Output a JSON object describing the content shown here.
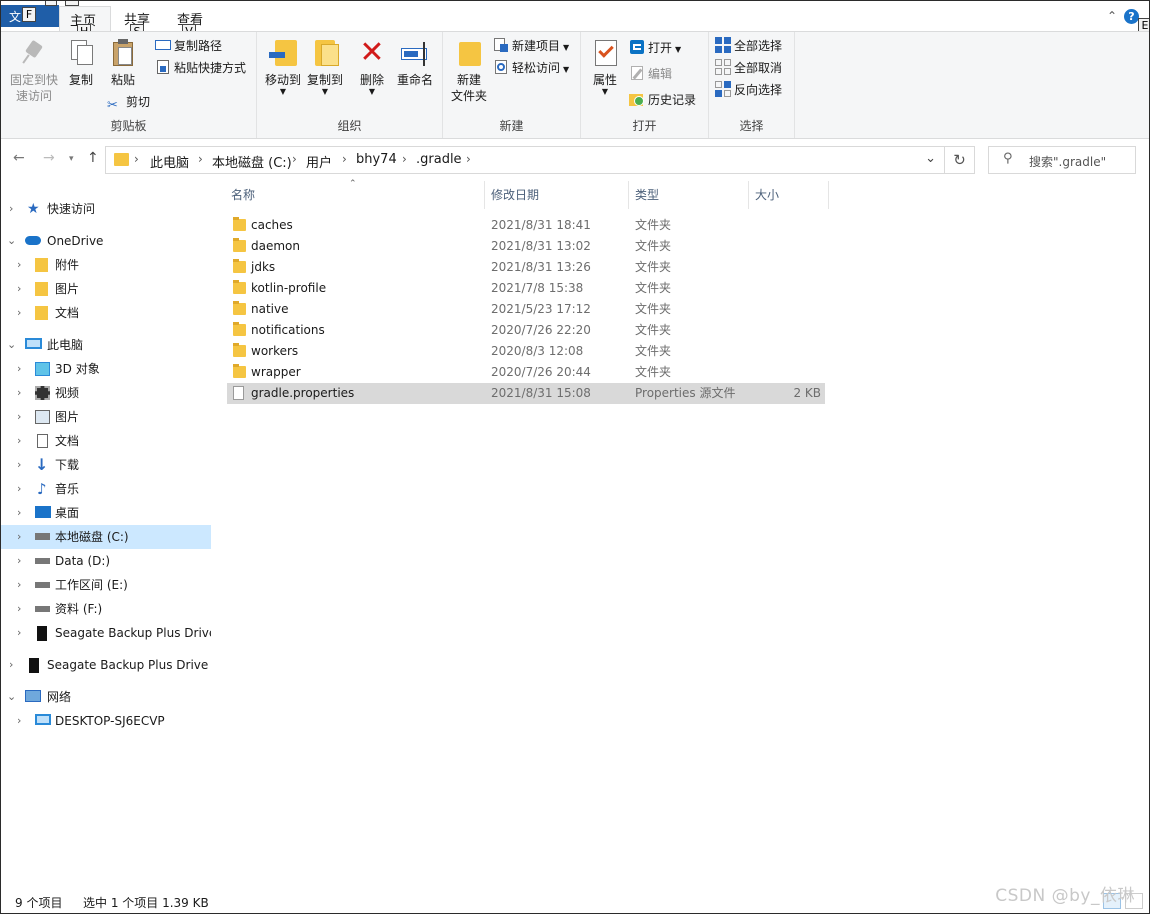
{
  "ribbon_tabs": {
    "file": "文",
    "home": "主页",
    "share": "共享",
    "view": "查看",
    "keytips": {
      "file": "F",
      "home": "H",
      "share": "S",
      "view": "V",
      "expand": "E"
    }
  },
  "ribbon": {
    "clipboard": {
      "pin_line1": "固定到快",
      "pin_line2": "速访问",
      "copy": "复制",
      "paste": "粘贴",
      "copy_path": "复制路径",
      "paste_shortcut": "粘贴快捷方式",
      "cut": "剪切",
      "label": "剪贴板"
    },
    "organize": {
      "move_to": "移动到",
      "copy_to": "复制到",
      "delete": "删除",
      "rename": "重命名",
      "label": "组织"
    },
    "new": {
      "new_folder_line1": "新建",
      "new_folder_line2": "文件夹",
      "new_item": "新建项目",
      "easy_access": "轻松访问",
      "label": "新建"
    },
    "open": {
      "properties": "属性",
      "open": "打开",
      "edit": "编辑",
      "history": "历史记录",
      "label": "打开"
    },
    "select": {
      "select_all": "全部选择",
      "select_none": "全部取消",
      "invert": "反向选择",
      "label": "选择"
    }
  },
  "address": {
    "crumbs": [
      "此电脑",
      "本地磁盘 (C:)",
      "用户",
      "bhy74",
      ".gradle"
    ],
    "search_placeholder": "搜索\".gradle\""
  },
  "nav": {
    "quick_access": "快速访问",
    "onedrive": "OneDrive",
    "od_attachments": "附件",
    "od_pictures": "图片",
    "od_documents": "文档",
    "this_pc": "此电脑",
    "objects3d": "3D 对象",
    "videos": "视频",
    "pictures": "图片",
    "documents": "文档",
    "downloads": "下载",
    "music": "音乐",
    "desktop": "桌面",
    "drive_c": "本地磁盘 (C:)",
    "drive_d": "Data (D:)",
    "drive_e": "工作区间 (E:)",
    "drive_f": "资料 (F:)",
    "seagate1": "Seagate Backup Plus Drive",
    "seagate2": "Seagate Backup Plus Drive (",
    "network": "网络",
    "desktop_pc": "DESKTOP-SJ6ECVP"
  },
  "columns": {
    "name": "名称",
    "date": "修改日期",
    "type": "类型",
    "size": "大小"
  },
  "files": [
    {
      "name": "caches",
      "date": "2021/8/31 18:41",
      "type": "文件夹",
      "size": ""
    },
    {
      "name": "daemon",
      "date": "2021/8/31 13:02",
      "type": "文件夹",
      "size": ""
    },
    {
      "name": "jdks",
      "date": "2021/8/31 13:26",
      "type": "文件夹",
      "size": ""
    },
    {
      "name": "kotlin-profile",
      "date": "2021/7/8 15:38",
      "type": "文件夹",
      "size": ""
    },
    {
      "name": "native",
      "date": "2021/5/23 17:12",
      "type": "文件夹",
      "size": ""
    },
    {
      "name": "notifications",
      "date": "2020/7/26 22:20",
      "type": "文件夹",
      "size": ""
    },
    {
      "name": "workers",
      "date": "2020/8/3 12:08",
      "type": "文件夹",
      "size": ""
    },
    {
      "name": "wrapper",
      "date": "2020/7/26 20:44",
      "type": "文件夹",
      "size": ""
    },
    {
      "name": "gradle.properties",
      "date": "2021/8/31 15:08",
      "type": "Properties 源文件",
      "size": "2 KB"
    }
  ],
  "status": {
    "count": "9 个项目",
    "selection": "选中 1 个项目  1.39 KB"
  },
  "watermark": "CSDN @by_依琳",
  "colors": {
    "accent": "#1f5ea8",
    "selected_nav": "#cce8ff",
    "selected_row": "#d9d9d9",
    "folder": "#f5c542"
  }
}
